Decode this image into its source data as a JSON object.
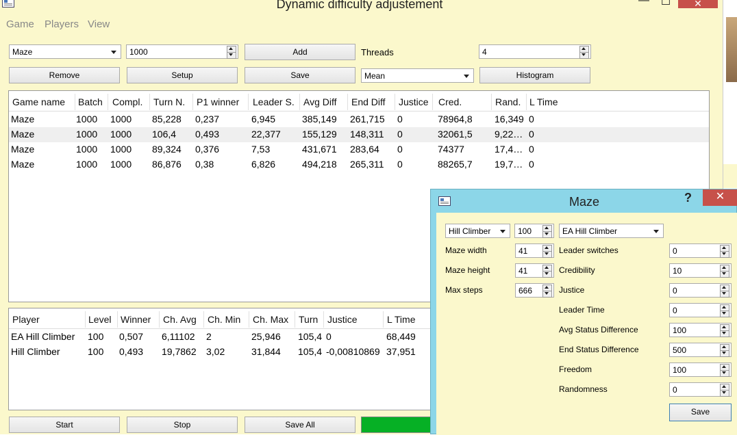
{
  "window": {
    "title": "Dynamic difficulty adjustement",
    "minimize": "—",
    "maximize": "☐",
    "close": "✕"
  },
  "menu": [
    "Game",
    "Players",
    "View"
  ],
  "toolbar": {
    "game_select": "Maze",
    "batch_value": "1000",
    "add": "Add",
    "threads_label": "Threads",
    "threads_value": "4",
    "remove": "Remove",
    "setup": "Setup",
    "save": "Save",
    "metric_select": "Mean",
    "histogram": "Histogram"
  },
  "games_table": {
    "headers": [
      "Game name",
      "Batch",
      "Compl.",
      "Turn N.",
      "P1 winner",
      "Leader S.",
      "Avg Diff",
      "End Diff",
      "Justice",
      "Cred.",
      "Rand.",
      "L Time"
    ],
    "rows": [
      [
        "Maze",
        "1000",
        "1000",
        "85,228",
        "0,237",
        "6,945",
        "385,149",
        "261,715",
        "0",
        "78964,8",
        "16,349",
        "0"
      ],
      [
        "Maze",
        "1000",
        "1000",
        "106,4",
        "0,493",
        "22,377",
        "155,129",
        "148,311",
        "0",
        "32061,5",
        "9,22…",
        "0"
      ],
      [
        "Maze",
        "1000",
        "1000",
        "89,324",
        "0,376",
        "7,53",
        "431,671",
        "283,64",
        "0",
        "74377",
        "17,4…",
        "0"
      ],
      [
        "Maze",
        "1000",
        "1000",
        "86,876",
        "0,38",
        "6,826",
        "494,218",
        "265,311",
        "0",
        "88265,7",
        "19,7…",
        "0"
      ]
    ]
  },
  "players_table": {
    "headers": [
      "Player",
      "Level",
      "Winner",
      "Ch. Avg",
      "Ch. Min",
      "Ch. Max",
      "Turn",
      "Justice",
      "L Time"
    ],
    "rows": [
      [
        "EA Hill Climber",
        "100",
        "0,507",
        "6,11102",
        "2",
        "25,946",
        "105,4",
        "0",
        "68,449"
      ],
      [
        "Hill Climber",
        "100",
        "0,493",
        "19,7862",
        "3,02",
        "31,844",
        "105,4",
        "-0,00810869",
        "37,951"
      ]
    ]
  },
  "bottom": {
    "start": "Start",
    "stop": "Stop",
    "save_all": "Save All",
    "progress": 1.0
  },
  "dialog": {
    "title": "Maze",
    "help": "?",
    "close": "✕",
    "player1": "Hill Climber",
    "level": "100",
    "player2": "EA Hill Climber",
    "left_fields": [
      {
        "label": "Maze width",
        "value": "41"
      },
      {
        "label": "Maze height",
        "value": "41"
      },
      {
        "label": "Max steps",
        "value": "666"
      }
    ],
    "right_fields": [
      {
        "label": "Leader switches",
        "value": "0"
      },
      {
        "label": "Credibility",
        "value": "10"
      },
      {
        "label": "Justice",
        "value": "0"
      },
      {
        "label": "Leader Time",
        "value": "0"
      },
      {
        "label": "Avg Status Difference",
        "value": "100"
      },
      {
        "label": "End Status Difference",
        "value": "500"
      },
      {
        "label": "Freedom",
        "value": "100"
      },
      {
        "label": "Randomness",
        "value": "0"
      }
    ],
    "save": "Save"
  }
}
